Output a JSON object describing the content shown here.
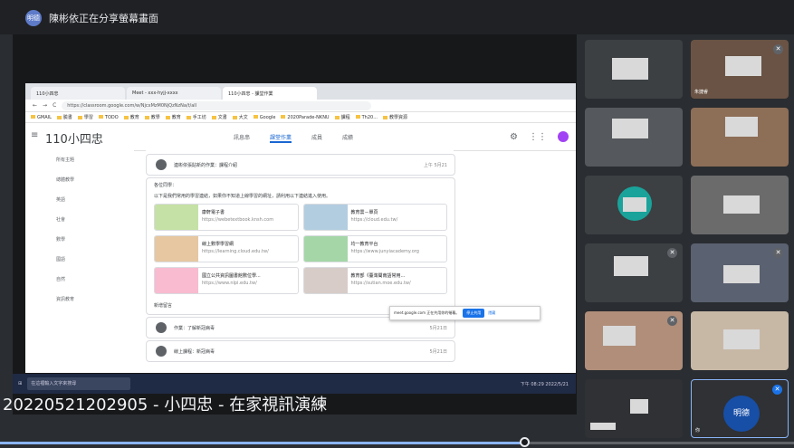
{
  "meeting": {
    "presenter_initials": "明德",
    "presenter_banner": "陳彬依正在分享螢幕畫面"
  },
  "caption": {
    "text": "20220521202905 - 小四忠 - 在家視訊演練"
  },
  "playback": {
    "progress_percent": 66
  },
  "shared_screen": {
    "tabs": [
      "110小四忠",
      "Meet - xxx-hyjj-xxxx",
      "110小四忠 - 課堂作業"
    ],
    "url": "https://classroom.google.com/w/NjcxMzM0NjQzNzNa/t/all",
    "bookmarks": [
      "GMAIL",
      "臉書",
      "學習",
      "TODO",
      "教育",
      "教學",
      "教育",
      "手工坊",
      "文書",
      "大文",
      "Google",
      "2020Parade-NKNU",
      "課程",
      "Th20...",
      "教學資源"
    ],
    "class_name": "110小四忠",
    "class_tabs": [
      "訊息串",
      "課堂作業",
      "成員",
      "成績"
    ],
    "sidebar_items": [
      "所有主題",
      "總體教學",
      "英語",
      "社會",
      "數學",
      "國語",
      "自然",
      "資訊教育"
    ],
    "post_top": "連彬依張貼新的作業：課程介紹",
    "post_top_date": "上午 5月21",
    "announce_heading": "各位同學：",
    "announce_body": "以下是我們常用的學習連結，如果你不知道上線學習的網址，請利用以下連結進入使用。",
    "links": [
      {
        "title": "康軒電子書",
        "url": "https://webetextbook.knsh.com"
      },
      {
        "title": "教育雲－單頁",
        "url": "https://cloud.edu.tw/"
      },
      {
        "title": "線上數學學習網",
        "url": "https://learning.cloud.edu.tw/"
      },
      {
        "title": "均一教育平台",
        "url": "https://www.junyiacademy.org"
      },
      {
        "title": "國立公共資訊圖書館數位學...",
        "url": "https://www.nlpi.edu.tw/"
      },
      {
        "title": "教育部《臺灣閩南語常用...",
        "url": "https://sutian.moe.edu.tw/"
      }
    ],
    "add_comment": "新增留言",
    "post_rows": [
      {
        "text": "作業：了解新冠病毒",
        "date": "5月21日"
      },
      {
        "text": "線上課程：新冠病毒",
        "date": "5月21日"
      }
    ],
    "notification": {
      "text": "meet.google.com 正在共用你的螢幕。",
      "stop": "停止共用",
      "hide": "隱藏"
    },
    "taskbar_search": "在這裡輸入文字來搜尋",
    "tray_time": "下午 08:29 2022/5/21"
  },
  "participants": [
    {
      "name": "",
      "muted": false
    },
    {
      "name": "朱捷睿",
      "muted": true
    },
    {
      "name": "",
      "muted": false
    },
    {
      "name": "",
      "muted": false
    },
    {
      "name": "",
      "muted": false
    },
    {
      "name": "",
      "muted": false
    },
    {
      "name": "",
      "muted": true
    },
    {
      "name": "",
      "muted": true
    },
    {
      "name": "",
      "muted": true
    },
    {
      "name": "",
      "muted": false
    },
    {
      "name": "",
      "muted": true
    },
    {
      "name": "你",
      "muted": true,
      "initials": "明德"
    }
  ],
  "colors": {
    "accent": "#1a73e8",
    "progress": "#8ab4f8",
    "avatar_teal": "#1aa39a"
  }
}
